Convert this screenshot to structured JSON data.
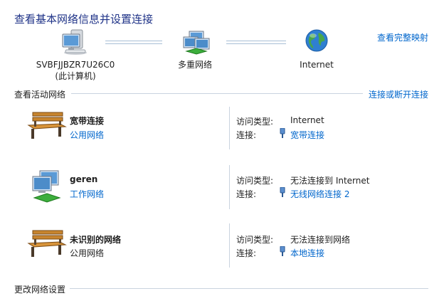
{
  "header": {
    "title": "查看基本网络信息并设置连接",
    "full_map_link": "查看完整映射"
  },
  "map": {
    "computer_name": "SVBFJJBZR7U26C0",
    "computer_sub": "(此计算机)",
    "middle_label": "多重网络",
    "internet_label": "Internet"
  },
  "active_section": {
    "title": "查看活动网络",
    "connect_link": "连接或断开连接"
  },
  "networks": [
    {
      "name": "宽带连接",
      "category": "公用网络",
      "category_is_link": true,
      "access_label": "访问类型:",
      "access_value": "Internet",
      "conn_label": "连接:",
      "conn_value": "宽带连接",
      "icon": "bench-icon"
    },
    {
      "name": "geren",
      "category": "工作网络",
      "category_is_link": true,
      "access_label": "访问类型:",
      "access_value": "无法连接到 Internet",
      "conn_label": "连接:",
      "conn_value": "无线网络连接 2",
      "icon": "work-network-icon"
    },
    {
      "name": "未识别的网络",
      "category": "公用网络",
      "category_is_link": false,
      "access_label": "访问类型:",
      "access_value": "无法连接到网络",
      "conn_label": "连接:",
      "conn_value": "本地连接",
      "icon": "bench-icon"
    }
  ],
  "change_section": {
    "title": "更改网络设置"
  },
  "colors": {
    "title": "#1e3287",
    "link": "#0066cc",
    "separator": "#c9d3df"
  }
}
